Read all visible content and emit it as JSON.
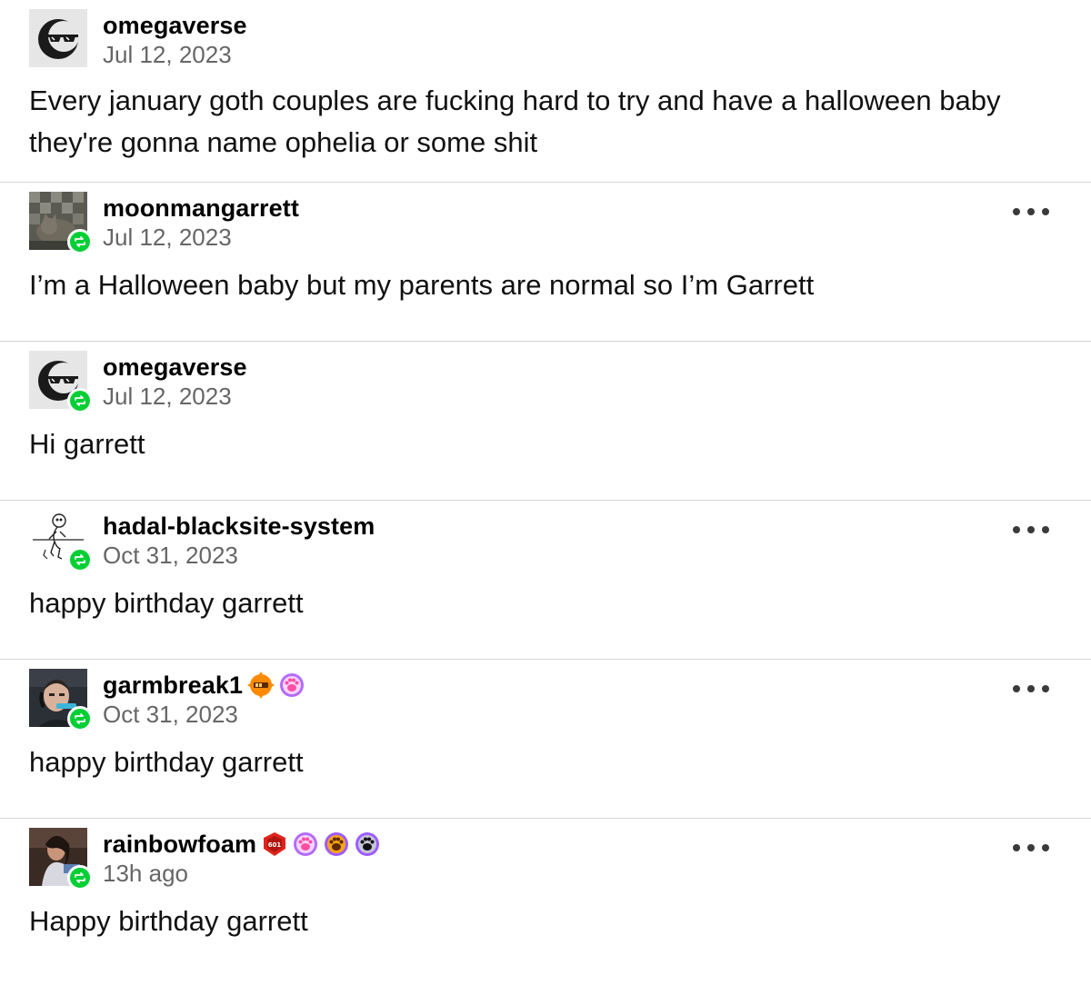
{
  "colors": {
    "reblog_badge": "#00cf35",
    "date_text": "#666666",
    "divider": "#d4d4d4"
  },
  "posts": [
    {
      "username": "omegaverse",
      "date": "Jul 12, 2023",
      "body": "Every january goth couples are fucking hard to try and have a halloween baby they're gonna name ophelia or some shit",
      "avatar_icon": "sunglasses-moon-avatar",
      "reblogged": false,
      "has_more_menu": false
    },
    {
      "username": "moonmangarrett",
      "date": "Jul 12, 2023",
      "body": "I’m a Halloween baby but my parents are normal so I’m Garrett",
      "avatar_icon": "cat-photo-avatar",
      "reblogged": true,
      "has_more_menu": true
    },
    {
      "username": "omegaverse",
      "date": "Jul 12, 2023",
      "body": "Hi garrett",
      "avatar_icon": "sunglasses-moon-avatar",
      "reblogged": true,
      "has_more_menu": false
    },
    {
      "username": "hadal-blacksite-system",
      "date": "Oct 31, 2023",
      "body": "happy birthday garrett",
      "avatar_icon": "sketch-figure-avatar",
      "reblogged": true,
      "has_more_menu": true
    },
    {
      "username": "garmbreak1",
      "date": "Oct 31, 2023",
      "body": "happy birthday garrett",
      "avatar_icon": "headset-person-avatar",
      "reblogged": true,
      "has_more_menu": true,
      "badges": [
        "orange-sun-badge",
        "pink-paw-badge"
      ]
    },
    {
      "username": "rainbowfoam",
      "date": "13h ago",
      "body": "Happy birthday garrett",
      "avatar_icon": "person-photo-avatar",
      "reblogged": true,
      "has_more_menu": true,
      "badges": [
        "red-shield-badge",
        "pink-paw-badge",
        "orange-paw-badge",
        "black-paw-badge"
      ]
    }
  ]
}
